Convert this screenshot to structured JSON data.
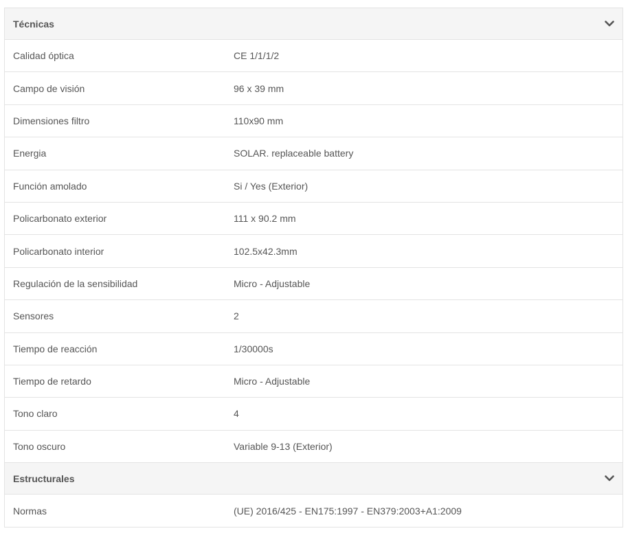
{
  "sections": [
    {
      "title": "Técnicas",
      "icon": "chevron-down-icon",
      "rows": [
        {
          "label": "Calidad óptica",
          "value": "CE 1/1/1/2"
        },
        {
          "label": "Campo de visión",
          "value": "96 x 39 mm"
        },
        {
          "label": "Dimensiones filtro",
          "value": "110x90 mm"
        },
        {
          "label": "Energia",
          "value": "SOLAR. replaceable battery"
        },
        {
          "label": "Función amolado",
          "value": "Si / Yes (Exterior)"
        },
        {
          "label": "Policarbonato exterior",
          "value": "111 x 90.2 mm"
        },
        {
          "label": "Policarbonato interior",
          "value": "102.5x42.3mm"
        },
        {
          "label": "Regulación de la sensibilidad",
          "value": "Micro - Adjustable"
        },
        {
          "label": "Sensores",
          "value": "2"
        },
        {
          "label": "Tiempo de reacción",
          "value": "1/30000s"
        },
        {
          "label": "Tiempo de retardo",
          "value": "Micro - Adjustable"
        },
        {
          "label": "Tono claro",
          "value": "4"
        },
        {
          "label": "Tono oscuro",
          "value": "Variable 9-13 (Exterior)"
        }
      ]
    },
    {
      "title": "Estructurales",
      "icon": "chevron-down-icon",
      "rows": [
        {
          "label": "Normas",
          "value": "(UE) 2016/425 - EN175:1997 - EN379:2003+A1:2009"
        }
      ]
    }
  ],
  "colors": {
    "header_bg": "#f5f5f5",
    "border": "#e3e3e3",
    "text": "#555555"
  }
}
